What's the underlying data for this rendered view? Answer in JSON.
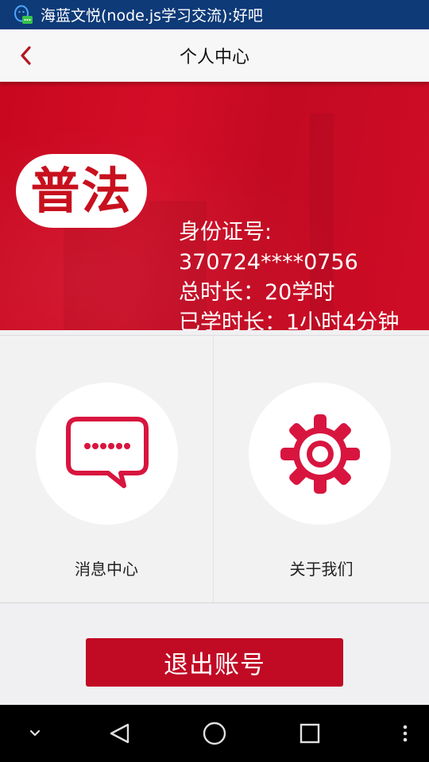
{
  "status_bar": {
    "notification_icon": "qq-penguin-icon",
    "message": "海蓝文悦(node.js学习交流):好吧"
  },
  "header": {
    "back_icon": "chevron-left-icon",
    "title": "个人中心"
  },
  "profile": {
    "logo_text": "普法",
    "id_label": "身份证号:",
    "id_value": "370724****0756",
    "total_hours": "总时长：20学时",
    "studied_time": "已学时长：1小时4分钟"
  },
  "menu": {
    "items": [
      {
        "label": "消息中心",
        "icon": "chat-bubble-icon"
      },
      {
        "label": "关于我们",
        "icon": "gear-icon"
      }
    ]
  },
  "logout": {
    "label": "退出账号"
  },
  "nav_bar": {
    "icons": [
      "chevron-down-icon",
      "back-triangle-icon",
      "home-circle-icon",
      "recents-square-icon",
      "more-vert-icon"
    ]
  },
  "colors": {
    "brand_red": "#c10a24",
    "status_bar": "#0e3a78",
    "icon_red": "#d8153f"
  }
}
